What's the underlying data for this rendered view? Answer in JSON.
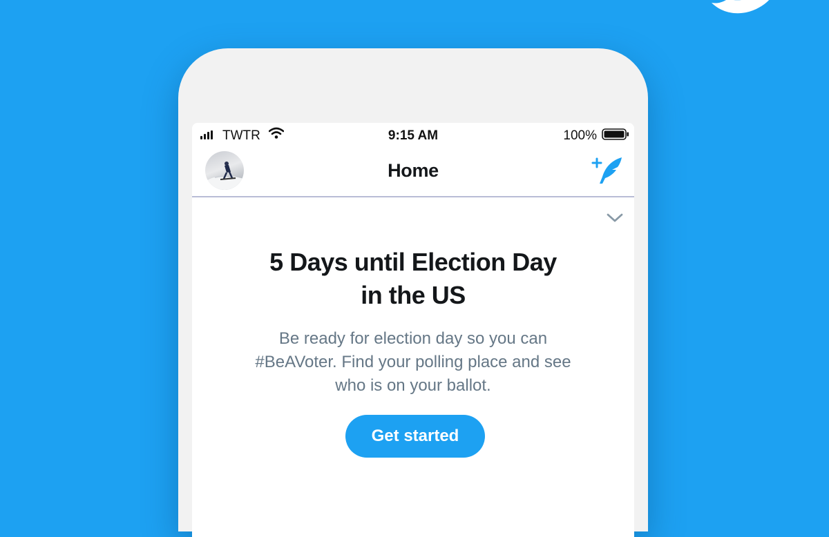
{
  "brand": {
    "accent_color": "#1da1f2",
    "logo_icon": "twitter-bird-icon"
  },
  "status_bar": {
    "carrier": "TWTR",
    "time": "9:15 AM",
    "battery_percent": "100%",
    "signal_icon": "signal-bars-icon",
    "wifi_icon": "wifi-icon",
    "battery_icon": "battery-full-icon"
  },
  "nav": {
    "title": "Home",
    "avatar_icon": "avatar",
    "compose_icon": "compose-tweet-icon"
  },
  "card": {
    "collapse_icon": "chevron-down-icon",
    "headline_lines": [
      "5 Days until Election Day",
      "in the US"
    ],
    "description_lines": [
      "Be ready for election day so you can",
      "#BeAVoter. Find your polling place and see",
      "who is on your ballot."
    ],
    "cta_label": "Get started"
  }
}
